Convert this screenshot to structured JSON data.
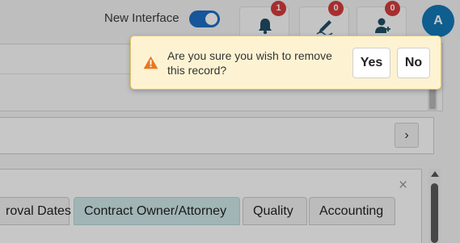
{
  "header": {
    "new_interface_label": "New Interface",
    "new_interface_on": true,
    "notifications_count": "1",
    "signature_count": "0",
    "contacts_count": "0",
    "avatar_letter": "A"
  },
  "tabs": [
    {
      "label": "roval Dates"
    },
    {
      "label": "Contract Owner/Attorney",
      "active": true
    },
    {
      "label": "Quality"
    },
    {
      "label": "Accounting"
    }
  ],
  "controls": {
    "next_glyph": "›",
    "close_glyph": "×"
  },
  "confirm": {
    "message": "Are you sure you wish to remove this record?",
    "yes_label": "Yes",
    "no_label": "No"
  },
  "colors": {
    "accent": "#1d6fc4",
    "badge": "#d63b3b",
    "avatar": "#1279b8",
    "popup_bg": "#fdf3d3",
    "warning": "#e87722",
    "active_tab": "#cfe8ea"
  },
  "icons": [
    "bell-icon",
    "signature-pen-icon",
    "user-add-icon",
    "warning-icon",
    "chevron-right-icon",
    "close-icon"
  ]
}
